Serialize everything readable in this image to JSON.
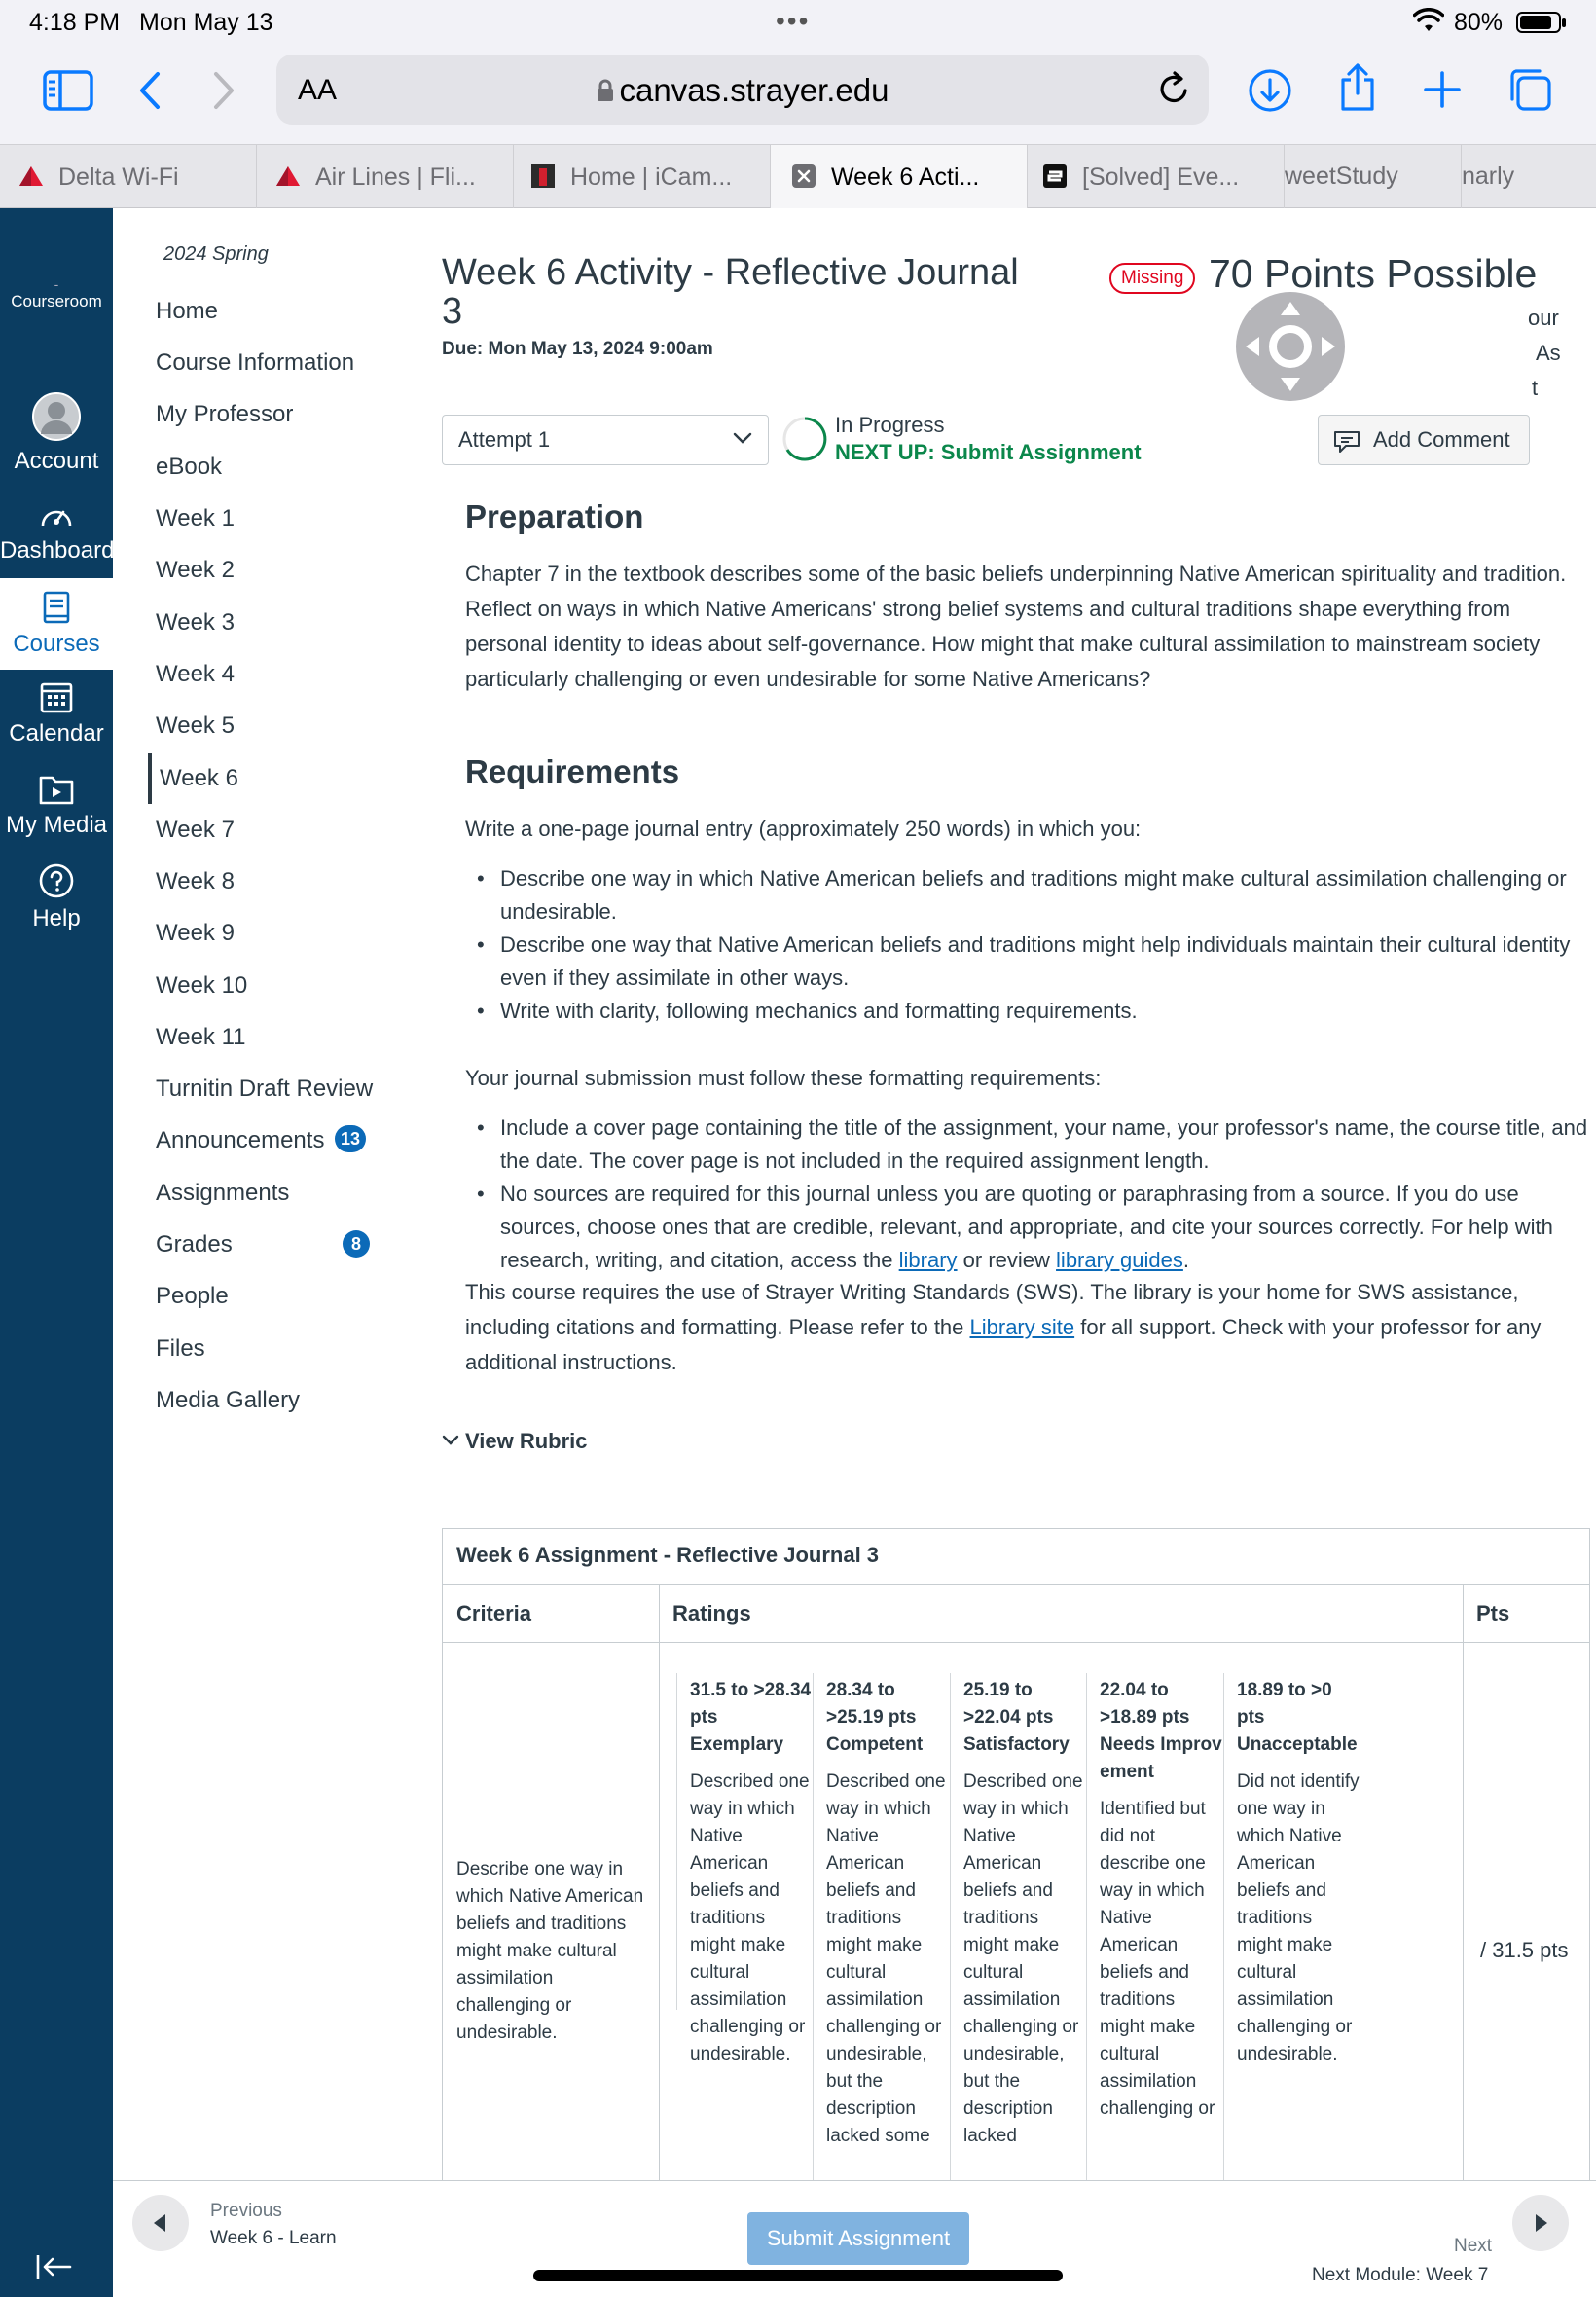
{
  "status": {
    "time": "4:18 PM",
    "date": "Mon May 13",
    "battery": "80%"
  },
  "browser": {
    "aa": "AA",
    "url": "canvas.strayer.edu",
    "tabs": [
      {
        "label": "Delta Wi-Fi"
      },
      {
        "label": "Air Lines | Fli..."
      },
      {
        "label": "Home | iCam..."
      },
      {
        "label": "Week 6 Acti..."
      },
      {
        "label": "[Solved] Eve..."
      },
      {
        "label": "weetStudy"
      },
      {
        "label": "narly"
      }
    ]
  },
  "global_nav": {
    "courseroom": "Courseroom",
    "items": [
      {
        "label": "Account",
        "icon": "user-avatar-icon"
      },
      {
        "label": "Dashboard",
        "icon": "dashboard-gauge-icon"
      },
      {
        "label": "Courses",
        "icon": "book-icon"
      },
      {
        "label": "Calendar",
        "icon": "calendar-icon"
      },
      {
        "label": "My Media",
        "icon": "media-folder-icon"
      },
      {
        "label": "Help",
        "icon": "help-icon"
      }
    ]
  },
  "course_nav": {
    "term": "2024 Spring",
    "items": [
      {
        "label": "Home"
      },
      {
        "label": "Course Information"
      },
      {
        "label": "My Professor"
      },
      {
        "label": "eBook"
      },
      {
        "label": "Week 1"
      },
      {
        "label": "Week 2"
      },
      {
        "label": "Week 3"
      },
      {
        "label": "Week 4"
      },
      {
        "label": "Week 5"
      },
      {
        "label": "Week 6"
      },
      {
        "label": "Week 7"
      },
      {
        "label": "Week 8"
      },
      {
        "label": "Week 9"
      },
      {
        "label": "Week 10"
      },
      {
        "label": "Week 11"
      },
      {
        "label": "Turnitin Draft Review"
      },
      {
        "label": "Announcements",
        "badge": "13"
      },
      {
        "label": "Assignments"
      },
      {
        "label": "Grades",
        "badge": "8"
      },
      {
        "label": "People"
      },
      {
        "label": "Files"
      },
      {
        "label": "Media Gallery"
      }
    ]
  },
  "assignment": {
    "title": "Week 6 Activity - Reflective Journal 3",
    "due": "Due: Mon May 13, 2024 9:00am",
    "missing": "Missing",
    "points": "70 Points Possible",
    "side_fragments": [
      "our",
      "As",
      "t"
    ],
    "attempt": "Attempt 1",
    "progress_status": "In Progress",
    "next_up": "NEXT UP: Submit Assignment",
    "add_comment": "Add Comment"
  },
  "content": {
    "prep_heading": "Preparation",
    "prep_text": "Chapter 7 in the textbook describes some of the basic beliefs underpinning Native American spirituality and tradition. Reflect on ways in which Native Americans' strong belief systems and cultural traditions shape everything from personal identity to ideas about self-governance. How might that make cultural assimilation to mainstream society particularly challenging or even undesirable for some Native Americans?",
    "req_heading": "Requirements",
    "req_intro": "Write a one-page journal entry (approximately 250 words) in which you:",
    "req_bullets": [
      "Describe one way in which Native American beliefs and traditions might make cultural assimilation challenging or undesirable.",
      "Describe one way that Native American beliefs and traditions might help individuals maintain their cultural identity even if they assimilate in other ways.",
      "Write with clarity, following mechanics and formatting requirements."
    ],
    "format_intro": "Your journal submission must follow these formatting requirements:",
    "format_bullet_1": "Include a cover page containing the title of the assignment, your name, your professor's name, the course title, and the date. The cover page is not included in the required assignment length.",
    "format_bullet_2_pre": "No sources are required for this journal unless you are quoting or paraphrasing from a source. If you do use sources, choose ones that are credible, relevant, and appropriate, and cite your sources correctly. For help with research, writing, and citation, access the ",
    "format_bullet_2_link1": "library",
    "format_bullet_2_mid": " or review ",
    "format_bullet_2_link2": "library guides",
    "format_bullet_2_post": ".",
    "sws_pre": "This course requires the use of Strayer Writing Standards (SWS). The library is your home for SWS assistance, including citations and formatting. Please refer to the ",
    "sws_link": "Library site",
    "sws_post": " for all support. Check with your professor for any additional instructions.",
    "view_rubric": "View Rubric"
  },
  "rubric": {
    "title": "Week 6 Assignment - Reflective Journal 3",
    "col_criteria": "Criteria",
    "col_ratings": "Ratings",
    "col_pts": "Pts",
    "criterion": "Describe one way in which Native American beliefs and traditions might make cultural assimilation challenging or undesirable.",
    "pts_value": "/ 31.5 pts",
    "ratings": [
      {
        "pts": "31.5 to >28.34 pts",
        "name": "Exemplary",
        "desc": "Described one way in which Native American beliefs and traditions might make cultural assimilation challenging or undesirable."
      },
      {
        "pts": "28.34 to >25.19 pts",
        "name": "Competent",
        "desc": "Described one way in which Native American beliefs and traditions might make cultural assimilation challenging or undesirable, but the description lacked some"
      },
      {
        "pts": "25.19 to >22.04 pts",
        "name": "Satisfactory",
        "desc": "Described one way in which Native American beliefs and traditions might make cultural assimilation challenging or undesirable, but the description lacked"
      },
      {
        "pts": "22.04 to >18.89 pts",
        "name": "Needs Improvement",
        "desc": "Identified but did not describe one way in which Native American beliefs and traditions might make cultural assimilation challenging or"
      },
      {
        "pts": "18.89 to >0 pts",
        "name": "Unacceptable",
        "desc": "Did not identify one way in which Native American beliefs and traditions might make cultural assimilation challenging or undesirable."
      }
    ]
  },
  "footer": {
    "prev_label": "Previous",
    "prev_target": "Week 6 - Learn",
    "submit": "Submit Assignment",
    "next_label": "Next",
    "next_target": "Next Module: Week 7"
  }
}
